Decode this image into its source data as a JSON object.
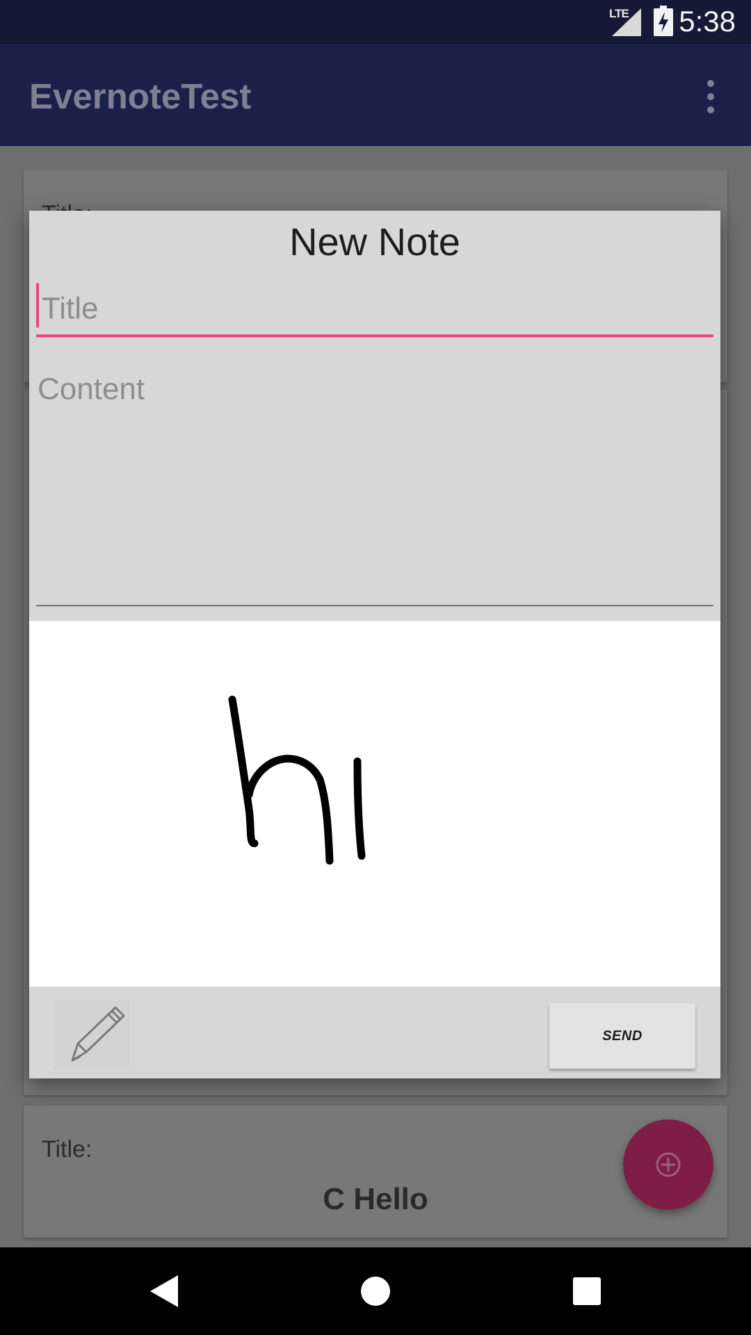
{
  "status_bar": {
    "network": "LTE",
    "time": "5:38",
    "icons": [
      "lte-signal-icon",
      "battery-charging-icon"
    ]
  },
  "app_bar": {
    "title": "EvernoteTest",
    "menu_icon": "overflow-menu-icon"
  },
  "background_cards": [
    {
      "title_label": "Title:"
    },
    {
      "title_label": ""
    },
    {
      "title_label": "Title:",
      "heading": "C Hello"
    }
  ],
  "fab": {
    "icon": "add-circle-icon"
  },
  "dialog": {
    "title": "New Note",
    "title_field": {
      "value": "",
      "placeholder": "Title"
    },
    "content_field": {
      "value": "",
      "placeholder": "Content"
    },
    "drawing": {
      "handwritten_text": "hi"
    },
    "pencil_icon": "pencil-icon",
    "send_label": "SEND"
  },
  "colors": {
    "accent": "#ee4582",
    "app_bar": "#1b2049",
    "status_bar": "#151a37",
    "fab": "#7f1e45"
  },
  "nav_bar": {
    "icons": [
      "back-icon",
      "home-icon",
      "recents-icon"
    ]
  }
}
